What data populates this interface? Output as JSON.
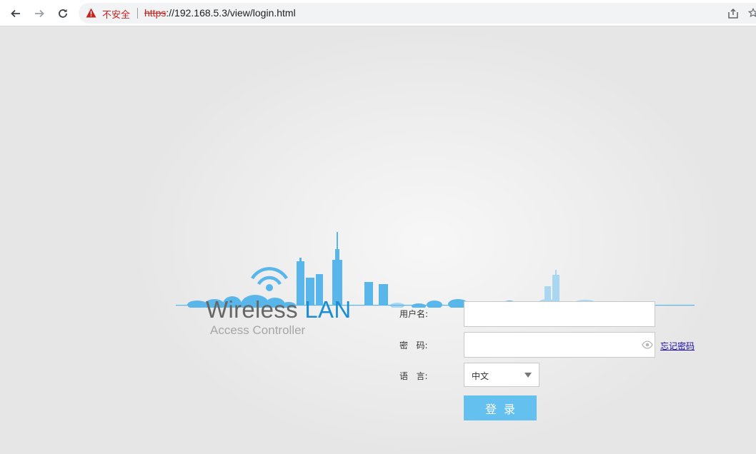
{
  "browser": {
    "security_label": "不安全",
    "url_scheme": "https",
    "url_rest": "://192.168.5.3/view/login.html"
  },
  "brand": {
    "title_part1": "Wireless ",
    "title_part2": "LAN",
    "subtitle": "Access Controller",
    "accent_color": "#1b8ed1",
    "skyline_color": "#59b6ea"
  },
  "login_form": {
    "username_label": "用户名:",
    "username_value": "",
    "password_label": "密   码:",
    "password_value": "",
    "forgot_password": "忘记密码",
    "language_label": "语   言:",
    "language_selected": "中文",
    "submit_label": "登录",
    "submit_color": "#64c0ee"
  }
}
